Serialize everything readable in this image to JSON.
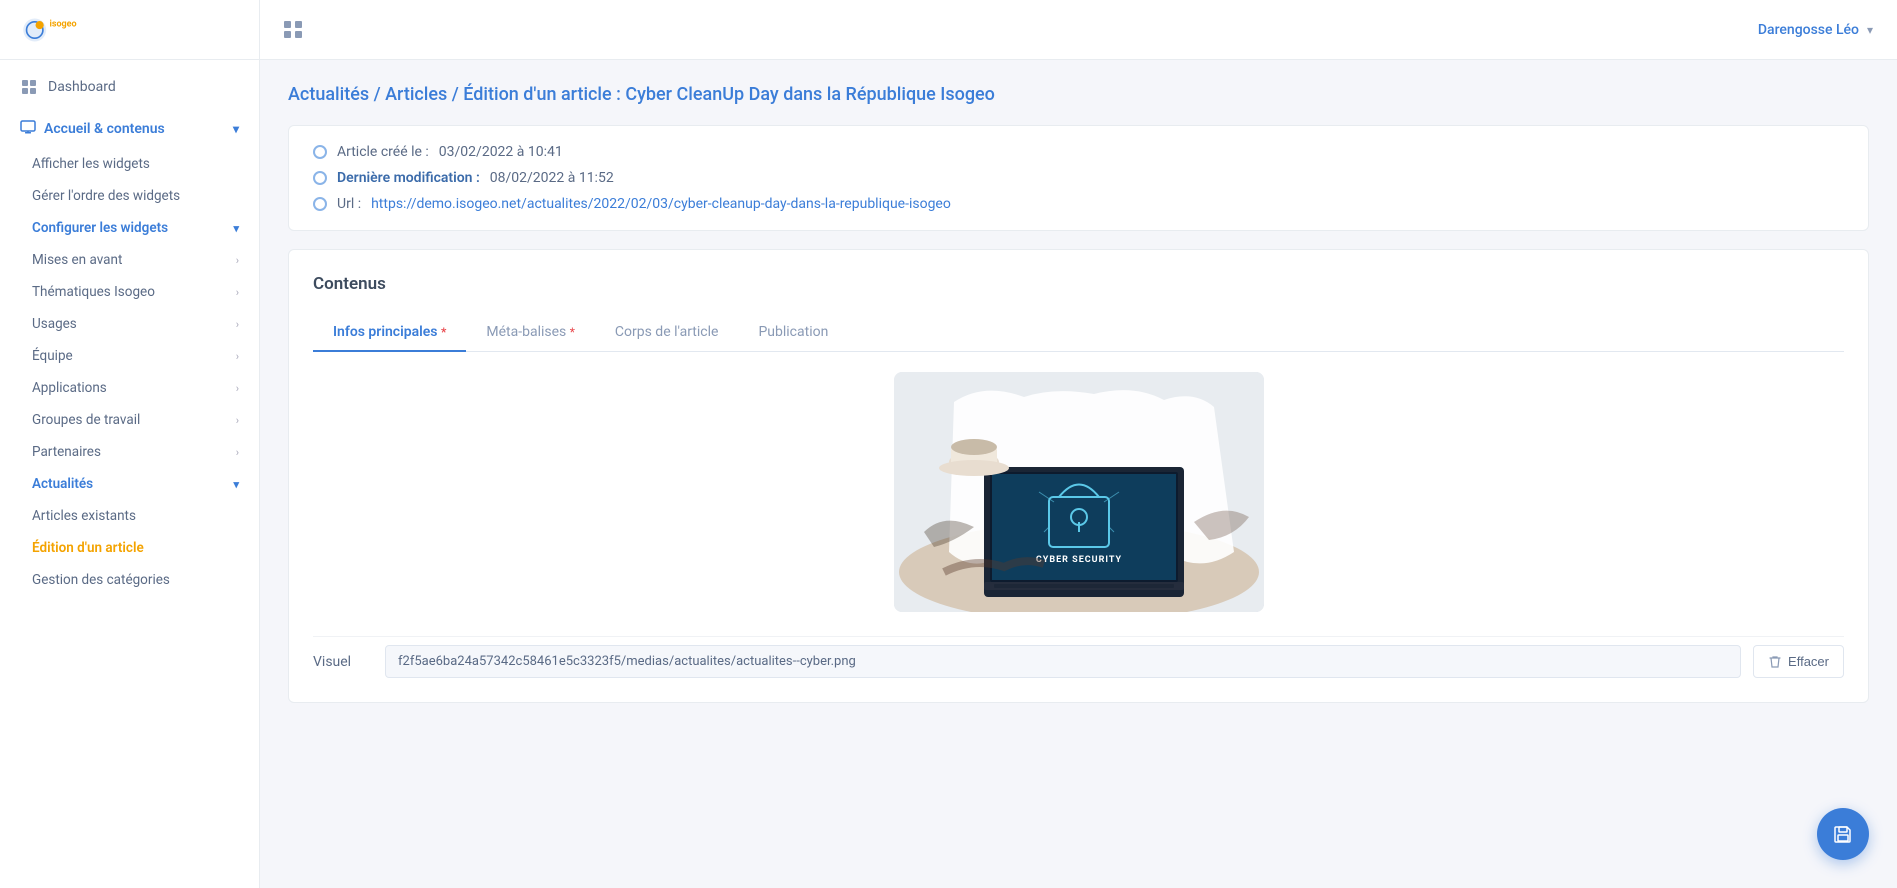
{
  "app": {
    "logo_text": "isogeo"
  },
  "topbar": {
    "grid_icon_label": "apps",
    "user_name": "Darengosse Léo",
    "chevron": "▾"
  },
  "breadcrumb": {
    "text": "Actualités / Articles / Édition d'un article : Cyber CleanUp Day dans la République Isogeo"
  },
  "info_card": {
    "created_label": "Article créé le :",
    "created_date": "03/02/2022 à 10:41",
    "modified_label": "Dernière modification :",
    "modified_date": "08/02/2022 à 11:52",
    "url_label": "Url :",
    "url_text": "https://demo.isogeo.net/actualites/2022/02/03/cyber-cleanup-day-dans-la-republique-isogeo",
    "url_href": "https://demo.isogeo.net/actualites/2022/02/03/cyber-cleanup-day-dans-la-republique-isogeo"
  },
  "content_card": {
    "title": "Contenus"
  },
  "tabs": [
    {
      "id": "infos",
      "label": "Infos principales",
      "required": true,
      "active": true
    },
    {
      "id": "meta",
      "label": "Méta-balises",
      "required": true,
      "active": false
    },
    {
      "id": "corps",
      "label": "Corps de l'article",
      "required": false,
      "active": false
    },
    {
      "id": "publication",
      "label": "Publication",
      "required": false,
      "active": false
    }
  ],
  "visuel": {
    "label": "Visuel",
    "value": "f2f5ae6ba24a57342c58461e5c3323f5/medias/actualites/actualites--cyber.png",
    "effacer_label": "Effacer"
  },
  "sidebar": {
    "dashboard": {
      "label": "Dashboard"
    },
    "accueil": {
      "label": "Accueil & contenus",
      "open": true
    },
    "sub_items": [
      {
        "id": "afficher-widgets",
        "label": "Afficher les widgets",
        "active": false
      },
      {
        "id": "gerer-widgets",
        "label": "Gérer l'ordre des widgets",
        "active": false
      }
    ],
    "configurer_widgets": {
      "label": "Configurer les widgets",
      "open": true
    },
    "config_sub": [
      {
        "id": "mises-en-avant",
        "label": "Mises en avant",
        "has_arrow": true
      },
      {
        "id": "thematiques",
        "label": "Thématiques Isogeo",
        "has_arrow": true
      },
      {
        "id": "usages",
        "label": "Usages",
        "has_arrow": true
      },
      {
        "id": "equipe",
        "label": "Équipe",
        "has_arrow": true
      },
      {
        "id": "applications",
        "label": "Applications",
        "has_arrow": true
      },
      {
        "id": "groupes",
        "label": "Groupes de travail",
        "has_arrow": true
      },
      {
        "id": "partenaires",
        "label": "Partenaires",
        "has_arrow": true
      }
    ],
    "actualites": {
      "label": "Actualités",
      "open": true
    },
    "actualites_sub": [
      {
        "id": "articles-existants",
        "label": "Articles existants",
        "active": false
      },
      {
        "id": "edition-article",
        "label": "Édition d'un article",
        "active": true
      },
      {
        "id": "gestion-categories",
        "label": "Gestion des catégories",
        "active": false
      }
    ]
  }
}
